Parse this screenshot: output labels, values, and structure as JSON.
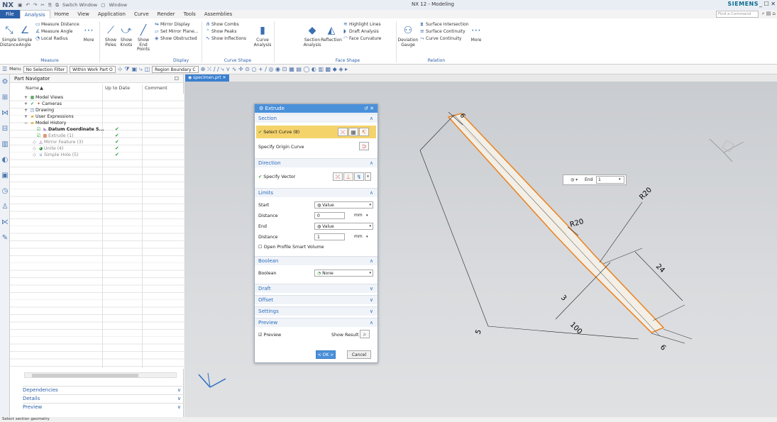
{
  "title_bar": {
    "app": "NX",
    "quick_access": {
      "switch_window": "Switch Window",
      "window_menu": "Window"
    },
    "title": "NX 12 - Modeling",
    "brand": "SIEMENS",
    "window_controls": "_ ☐ ✕"
  },
  "menu": {
    "tabs": [
      "File",
      "Analysis",
      "Home",
      "View",
      "Application",
      "Curve",
      "Render",
      "Tools",
      "Assemblies"
    ],
    "active": "Analysis",
    "find_placeholder": "Find a Command"
  },
  "ribbon": {
    "measure": {
      "simple_distance": "Simple Distance",
      "simple_angle": "Simple Angle",
      "measure_distance": "Measure Distance",
      "measure_angle": "Measure Angle",
      "local_radius": "Local Radius",
      "more": "More",
      "group": "Measure"
    },
    "display": {
      "show_poles": "Show Poles",
      "show_knots": "Show Knots",
      "show_end_points": "Show End Points",
      "mirror_display": "Mirror Display",
      "set_mirror_plane": "Set Mirror Plane...",
      "show_obstructed": "Show Obstructed",
      "group": "Display"
    },
    "curve_shape": {
      "show_combs": "Show Combs",
      "show_peaks": "Show Peaks",
      "show_inflections": "Show Inflections",
      "curve_analysis": "Curve Analysis",
      "group": "Curve Shape"
    },
    "face_shape": {
      "section_analysis": "Section Analysis",
      "reflection": "Reflection",
      "highlight_lines": "Highlight Lines",
      "draft_analysis": "Draft Analysis",
      "face_curvature": "Face Curvature",
      "group": "Face Shape"
    },
    "relation": {
      "deviation_gauge": "Deviation Gauge",
      "surface_intersection": "Surface Intersection",
      "surface_continuity": "Surface Continuity",
      "curve_continuity": "Curve Continuity",
      "more": "More",
      "group": "Relation"
    }
  },
  "toolbar": {
    "menu": "Menu",
    "selection_filter": "No Selection Filter",
    "scope": "Within Work Part O",
    "region": "Region Boundary C"
  },
  "part_navigator": {
    "title": "Part Navigator",
    "columns": {
      "name": "Name",
      "up_to_date": "Up to Date",
      "comment": "Comment"
    },
    "items": [
      {
        "label": "Model Views",
        "checked": false
      },
      {
        "label": "Cameras",
        "checked": false
      },
      {
        "label": "Drawing",
        "checked": false
      },
      {
        "label": "User Expressions",
        "checked": false
      },
      {
        "label": "Model History",
        "checked": false
      },
      {
        "label": "Datum Coordinate S...",
        "checked": true
      },
      {
        "label": "Extrude (1)",
        "checked": true
      },
      {
        "label": "Mirror Feature (3)",
        "checked": true
      },
      {
        "label": "Unite (4)",
        "checked": true
      },
      {
        "label": "Simple Hole (5)",
        "checked": true
      }
    ],
    "panels": [
      "Dependencies",
      "Details",
      "Preview"
    ]
  },
  "file_tab": "specimen.prt",
  "extrude_dialog": {
    "title": "Extrude",
    "section": {
      "label": "Section",
      "select_curve": "Select Curve (8)",
      "specify_origin": "Specify Origin Curve"
    },
    "direction": {
      "label": "Direction",
      "specify_vector": "Specify Vector"
    },
    "limits": {
      "label": "Limits",
      "start_label": "Start",
      "start_value": "Value",
      "distance1_label": "Distance",
      "distance1_value": "0",
      "distance1_unit": "mm",
      "end_label": "End",
      "end_value": "Value",
      "distance2_label": "Distance",
      "distance2_value": "1",
      "distance2_unit": "mm",
      "open_profile": "Open Profile Smart Volume"
    },
    "boolean": {
      "label": "Boolean",
      "field_label": "Boolean",
      "value": "None"
    },
    "draft": "Draft",
    "offset": "Offset",
    "settings": "Settings",
    "preview": {
      "label": "Preview",
      "preview_check": "Preview",
      "show_result": "Show Result"
    },
    "ok": "< OK >",
    "cancel": "Cancel"
  },
  "end_popup": {
    "label": "End",
    "value": "1"
  },
  "drawing": {
    "dim_r20_a": "R20",
    "dim_r20_b": "R20",
    "dim_24": "24",
    "dim_3": "3",
    "dim_100": "100",
    "dim_6": "6",
    "dim_5": "5",
    "dim_top": "6",
    "part_color": "#f3efe6",
    "edge_color": "#e8862a",
    "dim_color": "#222222"
  },
  "status": "Select section geometry"
}
